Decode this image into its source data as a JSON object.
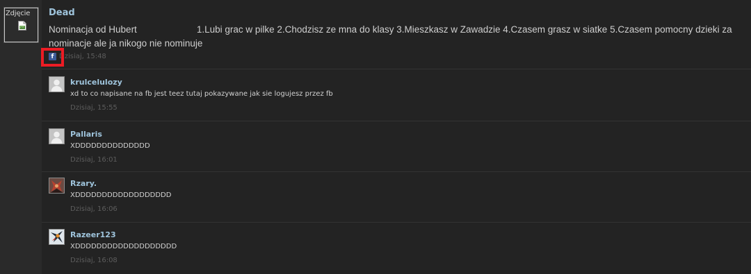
{
  "post": {
    "photo_alt": "Zdjęcie",
    "author": "Dead",
    "body_part1": "Nominacja od Hubert",
    "body_part2": "1.Lubi grac w pilke 2.Chodzisz ze mna do klasy 3.Mieszkasz w Zawadzie 4.Czasem grasz w siatke 5.Czasem pomocny dzieki za nominacje ale ja nikogo nie nominuje",
    "source_icon": "facebook-icon",
    "time": "Dzisiaj, 15:48"
  },
  "comments": [
    {
      "author": "krulcelulozy",
      "text": "xd to co napisane na fb jest teez tutaj pokazywane jak sie logujesz przez fb",
      "time": "Dzisiaj, 15:55",
      "avatar": "default-avatar"
    },
    {
      "author": "Pallaris",
      "text": "XDDDDDDDDDDDDDD",
      "time": "Dzisiaj, 16:01",
      "avatar": "default-avatar"
    },
    {
      "author": "Rzary.",
      "text": "XDDDDDDDDDDDDDDDDDD",
      "time": "Dzisiaj, 16:06",
      "avatar": "custom-avatar-red"
    },
    {
      "author": "Razeer123",
      "text": "XDDDDDDDDDDDDDDDDDDD",
      "time": "Dzisiaj, 16:08",
      "avatar": "custom-avatar-character"
    }
  ],
  "colors": {
    "background": "#232323",
    "author_link": "#9fc4dc",
    "timestamp": "#5d5d5d",
    "highlight": "#ec1c24",
    "facebook": "#3b5998"
  }
}
